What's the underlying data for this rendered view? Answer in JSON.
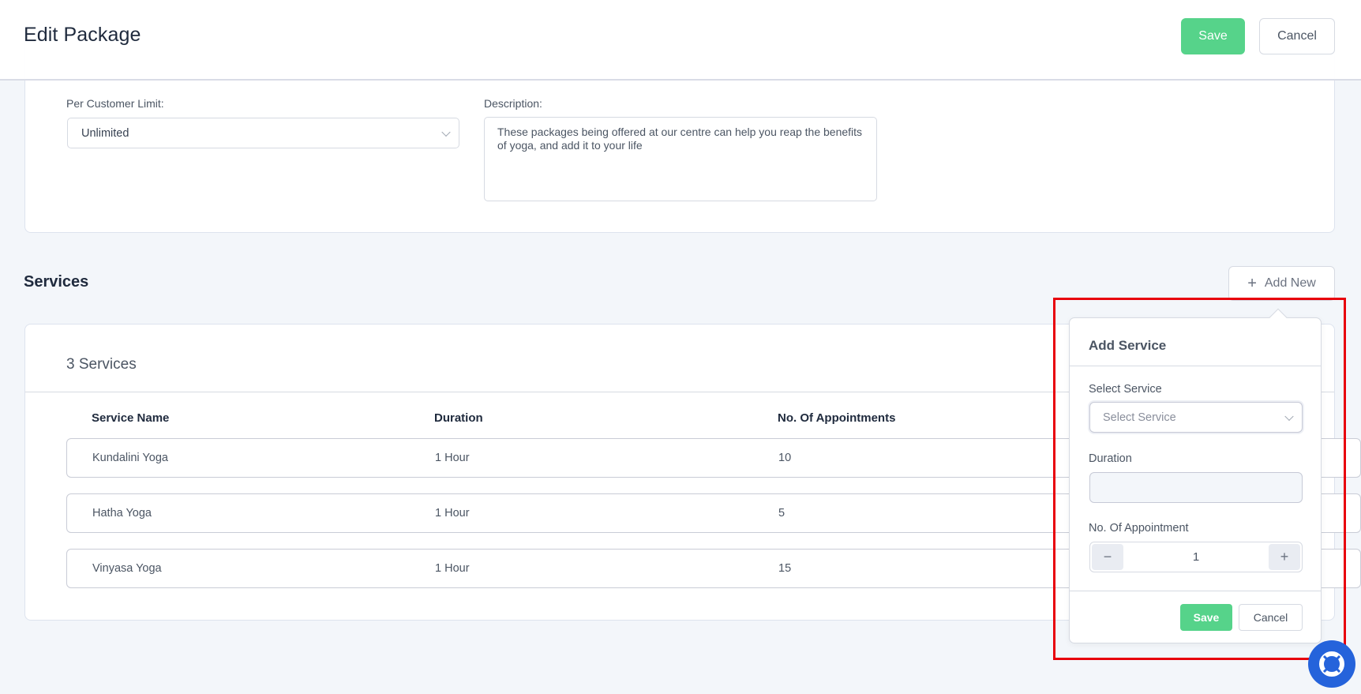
{
  "header": {
    "title": "Edit Package",
    "save_label": "Save",
    "cancel_label": "Cancel"
  },
  "form": {
    "per_customer_limit": {
      "label": "Per Customer Limit:",
      "value": "Unlimited"
    },
    "description": {
      "label": "Description:",
      "value": "These packages being offered at our centre can help you reap the benefits of yoga, and add it to your life"
    }
  },
  "services": {
    "section_title": "Services",
    "add_new_label": "Add New",
    "count_label": "3 Services",
    "columns": [
      "Service Name",
      "Duration",
      "No. Of Appointments"
    ],
    "rows": [
      {
        "name": "Kundalini Yoga",
        "duration": "1 Hour",
        "appointments": "10"
      },
      {
        "name": "Hatha Yoga",
        "duration": "1 Hour",
        "appointments": "5"
      },
      {
        "name": "Vinyasa Yoga",
        "duration": "1 Hour",
        "appointments": "15"
      }
    ]
  },
  "add_service_popover": {
    "title": "Add Service",
    "select_service": {
      "label": "Select Service",
      "placeholder": "Select Service"
    },
    "duration": {
      "label": "Duration",
      "value": ""
    },
    "appointments": {
      "label": "No. Of Appointment",
      "value": "1",
      "decrement": "−",
      "increment": "+"
    },
    "save_label": "Save",
    "cancel_label": "Cancel"
  },
  "icons": {
    "add": "plus-icon",
    "dropdown": "chevron-down-icon",
    "help": "lifebuoy-icon"
  },
  "colors": {
    "primary_green": "#56d38a",
    "help_blue": "#2563db",
    "highlight_red": "#e8000b",
    "page_bg": "#f3f6fa"
  }
}
